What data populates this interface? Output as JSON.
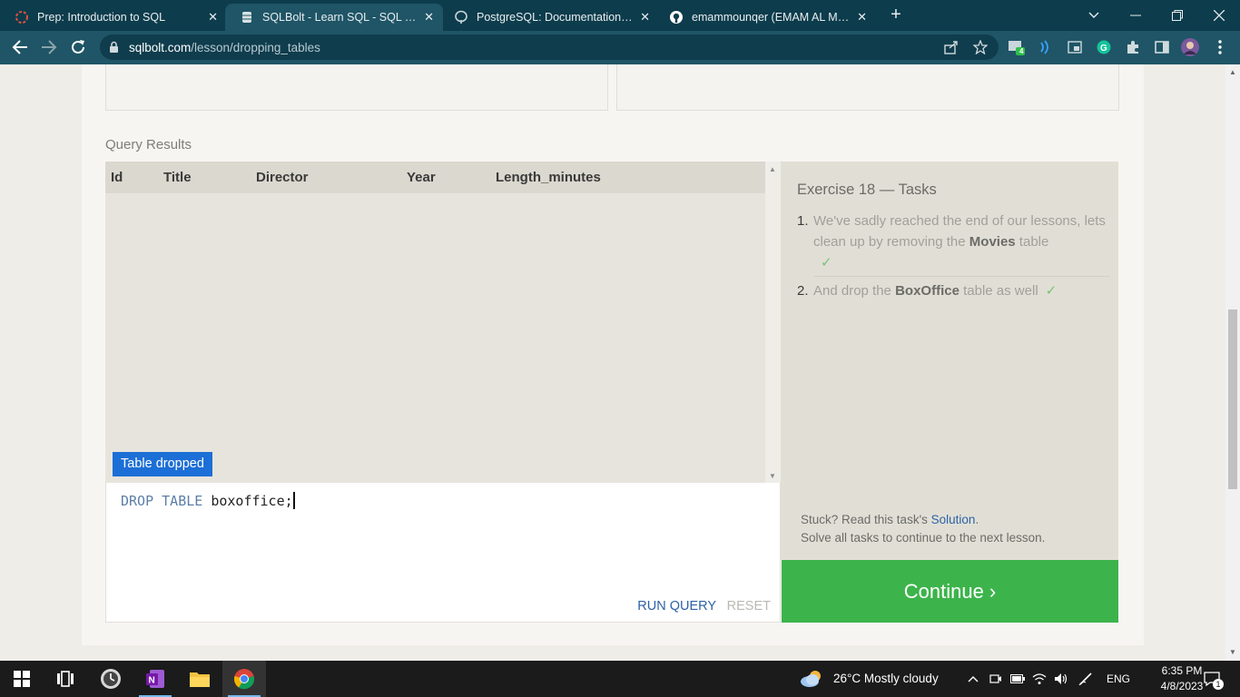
{
  "browser": {
    "tabs": [
      {
        "title": "Prep: Introduction to SQL",
        "icon": "prep-icon",
        "active": false
      },
      {
        "title": "SQLBolt - Learn SQL - SQL Lesson",
        "icon": "sqlbolt-icon",
        "active": true
      },
      {
        "title": "PostgreSQL: Documentation: 9.4",
        "icon": "postgres-icon",
        "active": false
      },
      {
        "title": "emammounqer (EMAM AL MOUNQER)",
        "icon": "github-icon",
        "active": false
      }
    ],
    "url_host": "sqlbolt.com",
    "url_path": "/lesson/dropping_tables",
    "extension_badge": "4"
  },
  "results": {
    "label": "Query Results",
    "columns": [
      "Id",
      "Title",
      "Director",
      "Year",
      "Length_minutes"
    ],
    "status_badge": "Table dropped"
  },
  "editor": {
    "code_kw1": "DROP",
    "code_kw2": "TABLE",
    "code_rest": "boxoffice;",
    "run_label": "RUN QUERY",
    "reset_label": "RESET"
  },
  "tasks": {
    "title": "Exercise 18 — Tasks",
    "items": [
      {
        "num": "1.",
        "pre": "We've sadly reached the end of our lessons, lets clean up by removing the ",
        "bold": "Movies",
        "post": " table",
        "check": "✓"
      },
      {
        "num": "2.",
        "pre": "And drop the ",
        "bold": "BoxOffice",
        "post": " table as well",
        "check": "✓"
      }
    ],
    "stuck_pre": "Stuck? Read this task's ",
    "stuck_link": "Solution",
    "stuck_post": ".",
    "solve_text": "Solve all tasks to continue to the next lesson.",
    "continue_label": "Continue ›"
  },
  "taskbar": {
    "weather": "26°C  Mostly cloudy",
    "lang": "ENG",
    "time": "6:35 PM",
    "date": "4/8/2023",
    "notifications": "1"
  },
  "colors": {
    "accent_blue": "#1c6fd6",
    "continue_green": "#3cb44b",
    "link_blue": "#2d62a6"
  }
}
